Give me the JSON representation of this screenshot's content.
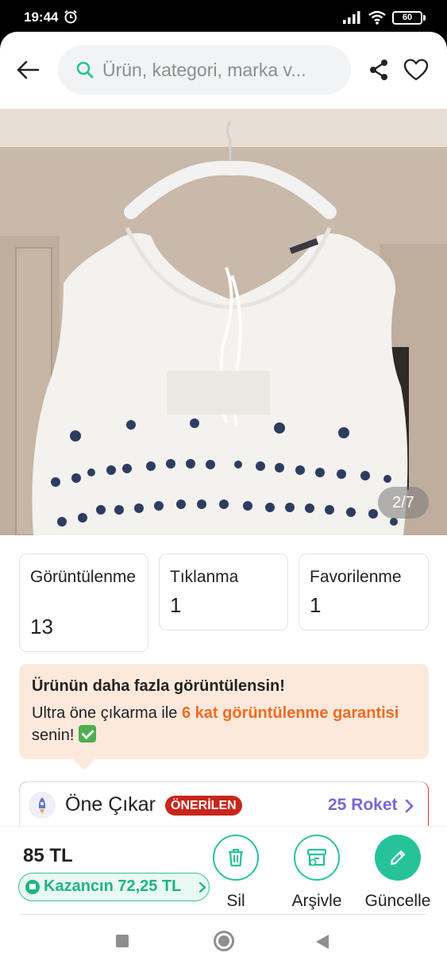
{
  "status_bar": {
    "time": "19:44",
    "battery": "60",
    "icons": [
      "alarm-icon",
      "signal-icon",
      "wifi-icon",
      "battery-icon"
    ]
  },
  "header": {
    "search_placeholder": "Ürün, kategori, marka v...",
    "icons": [
      "back-arrow-icon",
      "search-icon",
      "share-icon",
      "heart-icon"
    ]
  },
  "photo": {
    "counter": "2/7",
    "current": 2,
    "total": 7
  },
  "stats": [
    {
      "label": "Görüntülenme",
      "value": "13"
    },
    {
      "label": "Tıklanma",
      "value": "1"
    },
    {
      "label": "Favorilenme",
      "value": "1"
    }
  ],
  "promo": {
    "title": "Ürünün daha fazla görüntülensin!",
    "text_before": "Ultra öne çıkarma ile ",
    "highlight": "6 kat görüntülenme garantisi",
    "text_after": " senin! "
  },
  "boost": {
    "title": "Öne Çıkar",
    "badge": "ÖNERİLEN",
    "cost": "25 Roket"
  },
  "bottom": {
    "price": "85 TL",
    "earnings": "Kazancın 72,25 TL",
    "actions": [
      {
        "label": "Sil",
        "icon": "trash-icon"
      },
      {
        "label": "Arşivle",
        "icon": "archive-icon"
      },
      {
        "label": "Güncelle",
        "icon": "pencil-icon"
      }
    ]
  },
  "colors": {
    "accent": "#26c39b",
    "promo_bg": "#fde9dc",
    "promo_highlight": "#f26a21",
    "badge": "#c8261d",
    "rocket_text": "#7469d6"
  }
}
